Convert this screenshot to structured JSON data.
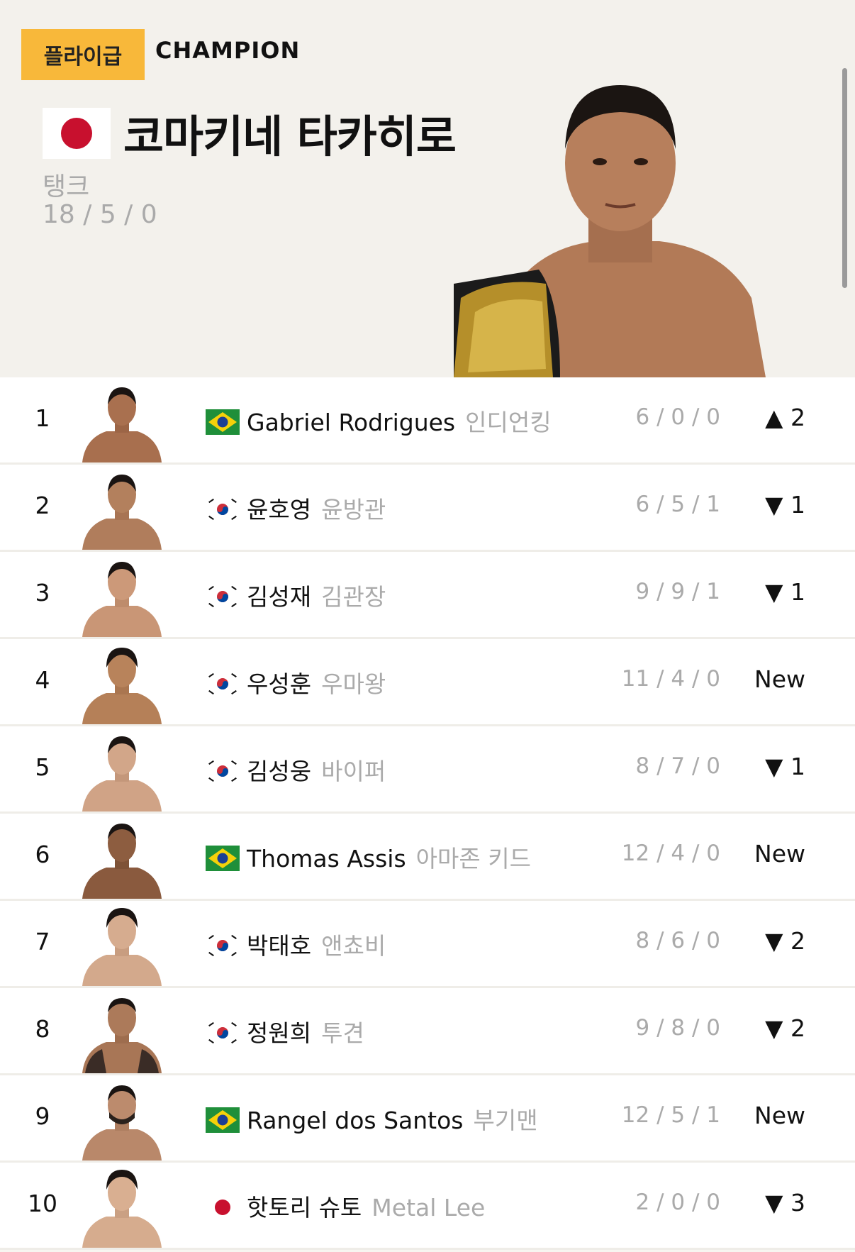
{
  "champion": {
    "division": "플라이급",
    "title": "CHAMPION",
    "name": "코마키네 타카히로",
    "nickname": "탱크",
    "record": "18 / 5 / 0",
    "flag": "japan"
  },
  "rankings": [
    {
      "rank": "1",
      "flag": "brazil",
      "name": "Gabriel Rodrigues",
      "nickname": "인디언킹",
      "record": "6 / 0 / 0",
      "change": "▲ 2"
    },
    {
      "rank": "2",
      "flag": "korea",
      "name": "윤호영",
      "nickname": "윤방관",
      "record": "6 / 5 / 1",
      "change": "▼ 1"
    },
    {
      "rank": "3",
      "flag": "korea",
      "name": "김성재",
      "nickname": "김관장",
      "record": "9 / 9 / 1",
      "change": "▼ 1"
    },
    {
      "rank": "4",
      "flag": "korea",
      "name": "우성훈",
      "nickname": "우마왕",
      "record": "11 / 4 / 0",
      "change": "New"
    },
    {
      "rank": "5",
      "flag": "korea",
      "name": "김성웅",
      "nickname": "바이퍼",
      "record": "8 / 7 / 0",
      "change": "▼ 1"
    },
    {
      "rank": "6",
      "flag": "brazil",
      "name": "Thomas Assis",
      "nickname": "아마존 키드",
      "record": "12 / 4 / 0",
      "change": "New"
    },
    {
      "rank": "7",
      "flag": "korea",
      "name": "박태호",
      "nickname": "앤쵸비",
      "record": "8 / 6 / 0",
      "change": "▼ 2"
    },
    {
      "rank": "8",
      "flag": "korea",
      "name": "정원희",
      "nickname": "투견",
      "record": "9 / 8 / 0",
      "change": "▼ 2"
    },
    {
      "rank": "9",
      "flag": "brazil",
      "name": "Rangel dos Santos",
      "nickname": "부기맨",
      "record": "12 / 5 / 1",
      "change": "New"
    },
    {
      "rank": "10",
      "flag": "japan",
      "name": "핫토리 슈토",
      "nickname": "Metal Lee",
      "record": "2 / 0 / 0",
      "change": "▼ 3"
    }
  ],
  "colors": {
    "badge": "#f8b83a",
    "hero_bg": "#f3f1ec",
    "muted_text": "#aaaaaa",
    "row_bg": "#ffffff"
  }
}
